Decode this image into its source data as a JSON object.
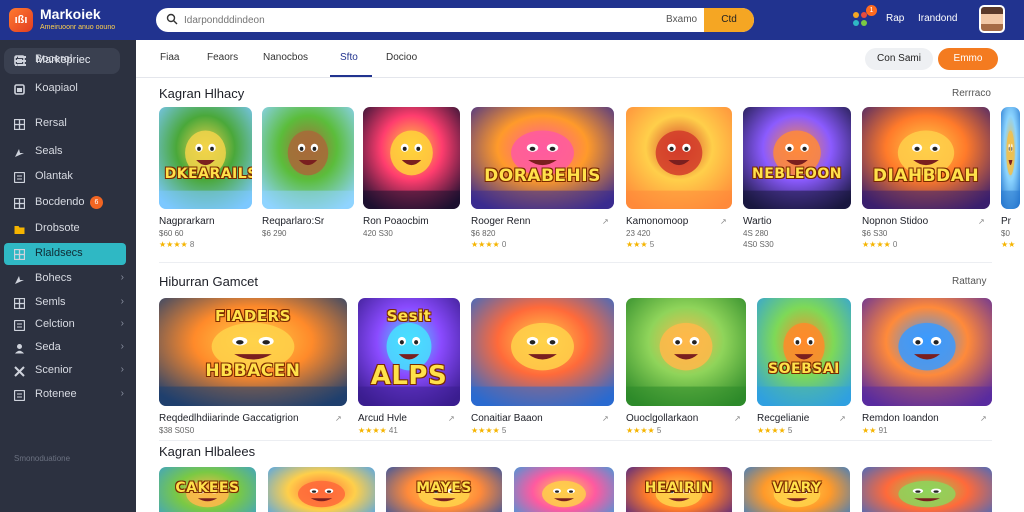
{
  "app": {
    "logo": "ıßı",
    "title": "Markoiek",
    "subtitle": "Ameiruoonr anuo oouno"
  },
  "search": {
    "placeholder": "Idarpondddindeon",
    "mid_text": "Bxamo",
    "button": "Ctd"
  },
  "header": {
    "badge": "1",
    "link1": "Rap",
    "link2": "Irandond",
    "avatar": "avatar"
  },
  "colors": {
    "topbar": "#21338f",
    "sidebar": "#2c3140",
    "accent": "#2fb8c4",
    "primary": "#f47b20",
    "star": "#f5b400"
  },
  "sidebar": {
    "header": "Markepriec",
    "footer": "Smonoduatione",
    "items": [
      {
        "label": "Bocerol",
        "icon": "square-icon"
      },
      {
        "label": "Koapiaol",
        "icon": "square-icon"
      },
      {
        "label": "Rersal",
        "icon": "grid-icon"
      },
      {
        "label": "Seals",
        "icon": "arrow-icon"
      },
      {
        "label": "Olantak",
        "icon": "list-icon"
      },
      {
        "label": "Bocdendo",
        "icon": "grid-icon",
        "badge": "6"
      },
      {
        "label": "Drobsote",
        "icon": "folder-icon"
      },
      {
        "label": "Rlaldsecs",
        "icon": "grid-icon"
      },
      {
        "label": "Bohecs",
        "icon": "arrow-icon"
      },
      {
        "label": "Semls",
        "icon": "grid-icon"
      },
      {
        "label": "Celction",
        "icon": "list-icon"
      },
      {
        "label": "Seda",
        "icon": "person-icon"
      },
      {
        "label": "Scenior",
        "icon": "tools-icon"
      },
      {
        "label": "Rotenee",
        "icon": "list-icon"
      }
    ]
  },
  "tabs": [
    "Fiaa",
    "Feaors",
    "Nanocbos",
    "Sfto",
    "Docioo"
  ],
  "actions": {
    "secondary": "Con Sami",
    "primary": "Emmo"
  },
  "sections": [
    {
      "title": "Kagran Hlhacy",
      "more": "Rerrraco",
      "cards": [
        {
          "name": "Nagprarkarn",
          "meta": "$60 60",
          "stars": "★★★★",
          "count": "8",
          "art_text": "DKEARAILS"
        },
        {
          "name": "Reqparlaro:Sr",
          "meta": "$6 290",
          "stars": "",
          "count": "",
          "art_text": ""
        },
        {
          "name": "Ron Poaocbim",
          "meta": "420 S30",
          "stars": "",
          "count": "",
          "art_text": ""
        },
        {
          "name": "Rooger Renn",
          "meta": "$6 820",
          "stars": "★★★★",
          "count": "0",
          "art_text": "DORABEHIS"
        },
        {
          "name": "Kamonomoop",
          "meta": "23 420",
          "stars": "★★★",
          "count": "5",
          "art_text": ""
        },
        {
          "name": "Wartio",
          "meta": "4S 280",
          "stars": "",
          "count": "",
          "art_text": "NEBLEOON",
          "meta2": "4S0 S30"
        },
        {
          "name": "Nopnon Stidoo",
          "meta": "$6 S30",
          "stars": "★★★★",
          "count": "0",
          "art_text": "DIAHBDAH"
        },
        {
          "name": "Pr",
          "meta": "$0",
          "stars": "★★",
          "count": "",
          "art_text": ""
        }
      ]
    },
    {
      "title": "Hiburran Gamcet",
      "more": "Rattany",
      "cards": [
        {
          "name": "Reqdedlhdiiarinde Gaccatigrion",
          "meta": "$38 S0S0",
          "stars": "",
          "count": "",
          "art_text": "HBBACEN",
          "art_top": "FIADERS"
        },
        {
          "name": "Arcud Hvle",
          "meta": "",
          "stars": "★★★★",
          "count": "41",
          "art_text": "ALPS",
          "art_top": "Sesit"
        },
        {
          "name": "Conaitiar Baaon",
          "meta": "",
          "stars": "★★★★",
          "count": "5",
          "art_text": ""
        },
        {
          "name": "Ouoclgollarkaon",
          "meta": "",
          "stars": "★★★★",
          "count": "5",
          "art_text": ""
        },
        {
          "name": "Recgelianie",
          "meta": "",
          "stars": "★★★★",
          "count": "5",
          "art_text": "SOEBSAI"
        },
        {
          "name": "Remdon Ioandon",
          "meta": "",
          "stars": "★★",
          "count": "91",
          "art_text": ""
        }
      ]
    },
    {
      "title": "Kagran Hlbalees",
      "more": "",
      "cards": [
        {
          "name": "",
          "art_text": "CAKEES"
        },
        {
          "name": "",
          "art_text": ""
        },
        {
          "name": "",
          "art_text": "MAYES"
        },
        {
          "name": "",
          "art_text": ""
        },
        {
          "name": "",
          "art_text": "HEAIRIN"
        },
        {
          "name": "",
          "art_text": "VIARY"
        },
        {
          "name": "",
          "art_text": ""
        }
      ]
    }
  ]
}
